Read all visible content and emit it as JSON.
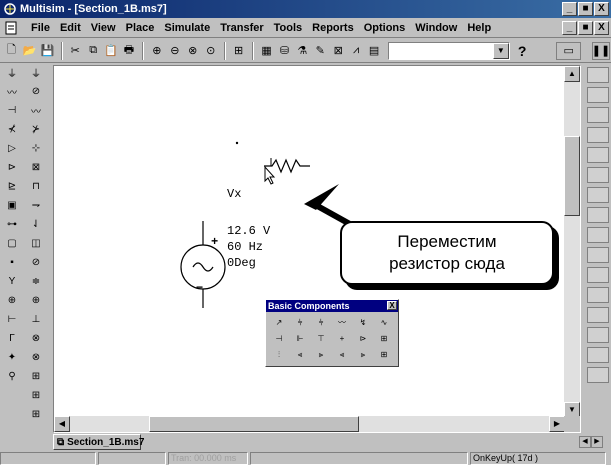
{
  "window": {
    "title": "Multisim - [Section_1B.ms7]",
    "min": "_",
    "max": "■",
    "close": "X"
  },
  "menu": {
    "items": [
      "File",
      "Edit",
      "View",
      "Place",
      "Simulate",
      "Transfer",
      "Tools",
      "Reports",
      "Options",
      "Window",
      "Help"
    ]
  },
  "toolbar": {
    "combo_value": "",
    "help_glyph": "?"
  },
  "schematic": {
    "source_label": "Vx",
    "source_voltage": "12.6 V",
    "source_freq": "60 Hz",
    "source_phase": "0Deg",
    "plus": "+",
    "minus": "−"
  },
  "callout": {
    "line1": "Переместим",
    "line2": "резистор сюда"
  },
  "palette": {
    "title": "Basic Components",
    "close": "X"
  },
  "tabs": {
    "active": "Section_1B.ms7"
  },
  "status": {
    "sim": "Tran: 00.000 ms",
    "message": "OnKeyUp( 17d )"
  }
}
